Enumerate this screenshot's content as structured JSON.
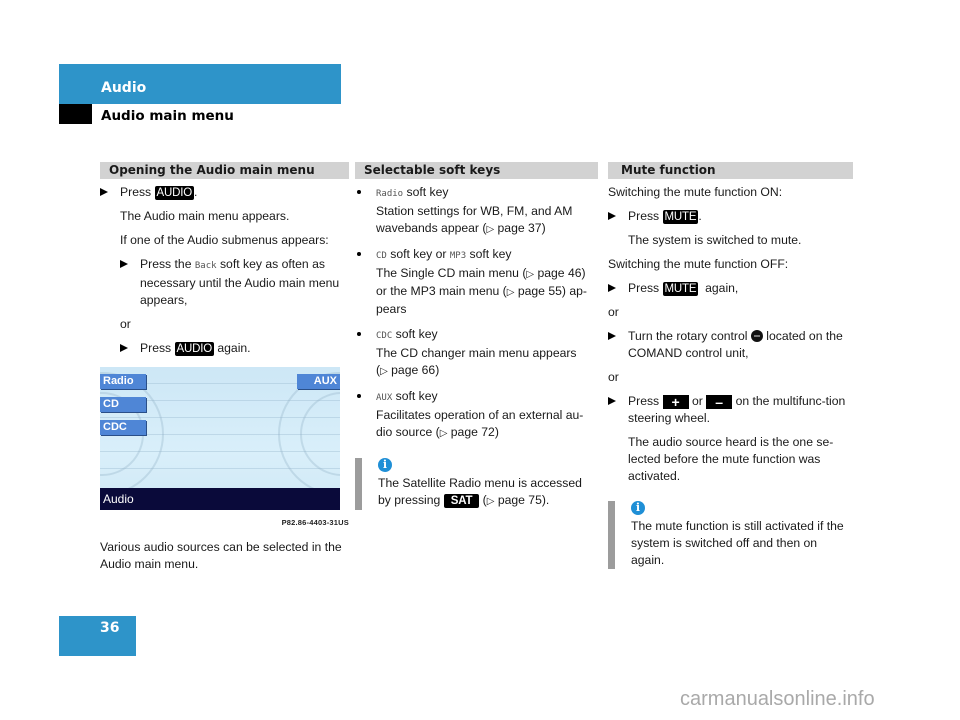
{
  "header": {
    "section": "Audio",
    "subsection": "Audio main menu"
  },
  "col1": {
    "heading": "Opening the Audio main menu",
    "step1_prefix": "Press",
    "key_audio": "AUDIO",
    "step1_suffix": ".",
    "result1": "The Audio main menu appears.",
    "condition": "If one of the Audio submenus appears:",
    "substep1_prefix": "Press the",
    "softkey_back": "Back",
    "substep1_suffix": "soft key as often as necessary until the Audio main menu appears,",
    "or": "or",
    "substep2_prefix": "Press",
    "substep2_suffix": "again.",
    "screen": {
      "softkeys_left": [
        "Radio",
        "CD",
        "CDC"
      ],
      "softkey_right": "AUX",
      "status_bar": "Audio"
    },
    "figure_code": "P82.86-4403-31US",
    "caption": "Various audio sources can be selected in the Audio main menu."
  },
  "col2": {
    "heading": "Selectable soft keys",
    "soft_key_word": "soft key",
    "or_word": "or",
    "items": [
      {
        "key": "Radio",
        "desc": "Station settings for WB, FM, and AM wavebands appear (",
        "page": "page 37",
        "end": ")"
      },
      {
        "key": "CD",
        "key2": "MP3",
        "desc": "The Single CD main menu (",
        "page": "page 46",
        "mid": ") or the MP3 main menu (",
        "page2": "page 55",
        "end": ") ap-pears"
      },
      {
        "key": "CDC",
        "desc": "The CD changer main menu appears (",
        "page": "page 66",
        "end": ")"
      },
      {
        "key": "AUX",
        "desc": "Facilitates operation of an external au-dio source (",
        "page": "page 72",
        "end": ")"
      }
    ],
    "note": {
      "icon": "info-icon",
      "text_prefix": "The Satellite Radio menu is accessed by pressing",
      "key": "SAT",
      "text_mid": "(",
      "page": "page 75",
      "text_end": ")."
    }
  },
  "col3": {
    "heading": "Mute function",
    "on_label": "Switching the mute function ON:",
    "step_on_prefix": "Press",
    "key_mute": "MUTE",
    "step_on_suffix": ".",
    "result_on": "The system is switched to mute.",
    "off_label": "Switching the mute function OFF:",
    "step_off1_prefix": "Press",
    "step_off1_suffix": "again,",
    "or": "or",
    "step_off2_prefix": "Turn the rotary control",
    "step_off2_suffix": "located on the COMAND control unit,",
    "step_off3_prefix": "Press",
    "key_plus": "+",
    "step_off3_or": "or",
    "key_minus": "–",
    "step_off3_suffix": "on the multifunc-tion steering wheel.",
    "result_off": "The audio source heard is the one se-lected before the mute function was activated.",
    "note": {
      "icon": "info-icon",
      "text": "The mute function is still activated if the system is switched off and then on again."
    }
  },
  "footer": {
    "page_number": "36",
    "watermark": "carmanualsonline.info"
  },
  "glyphs": {
    "pageref_triangle": "▷",
    "info": "i"
  },
  "colors": {
    "accent_blue": "#2e94c9",
    "section_gray": "#d2d2d2",
    "note_bar": "#9c9c9c",
    "info_blue": "#1f8fd6"
  }
}
